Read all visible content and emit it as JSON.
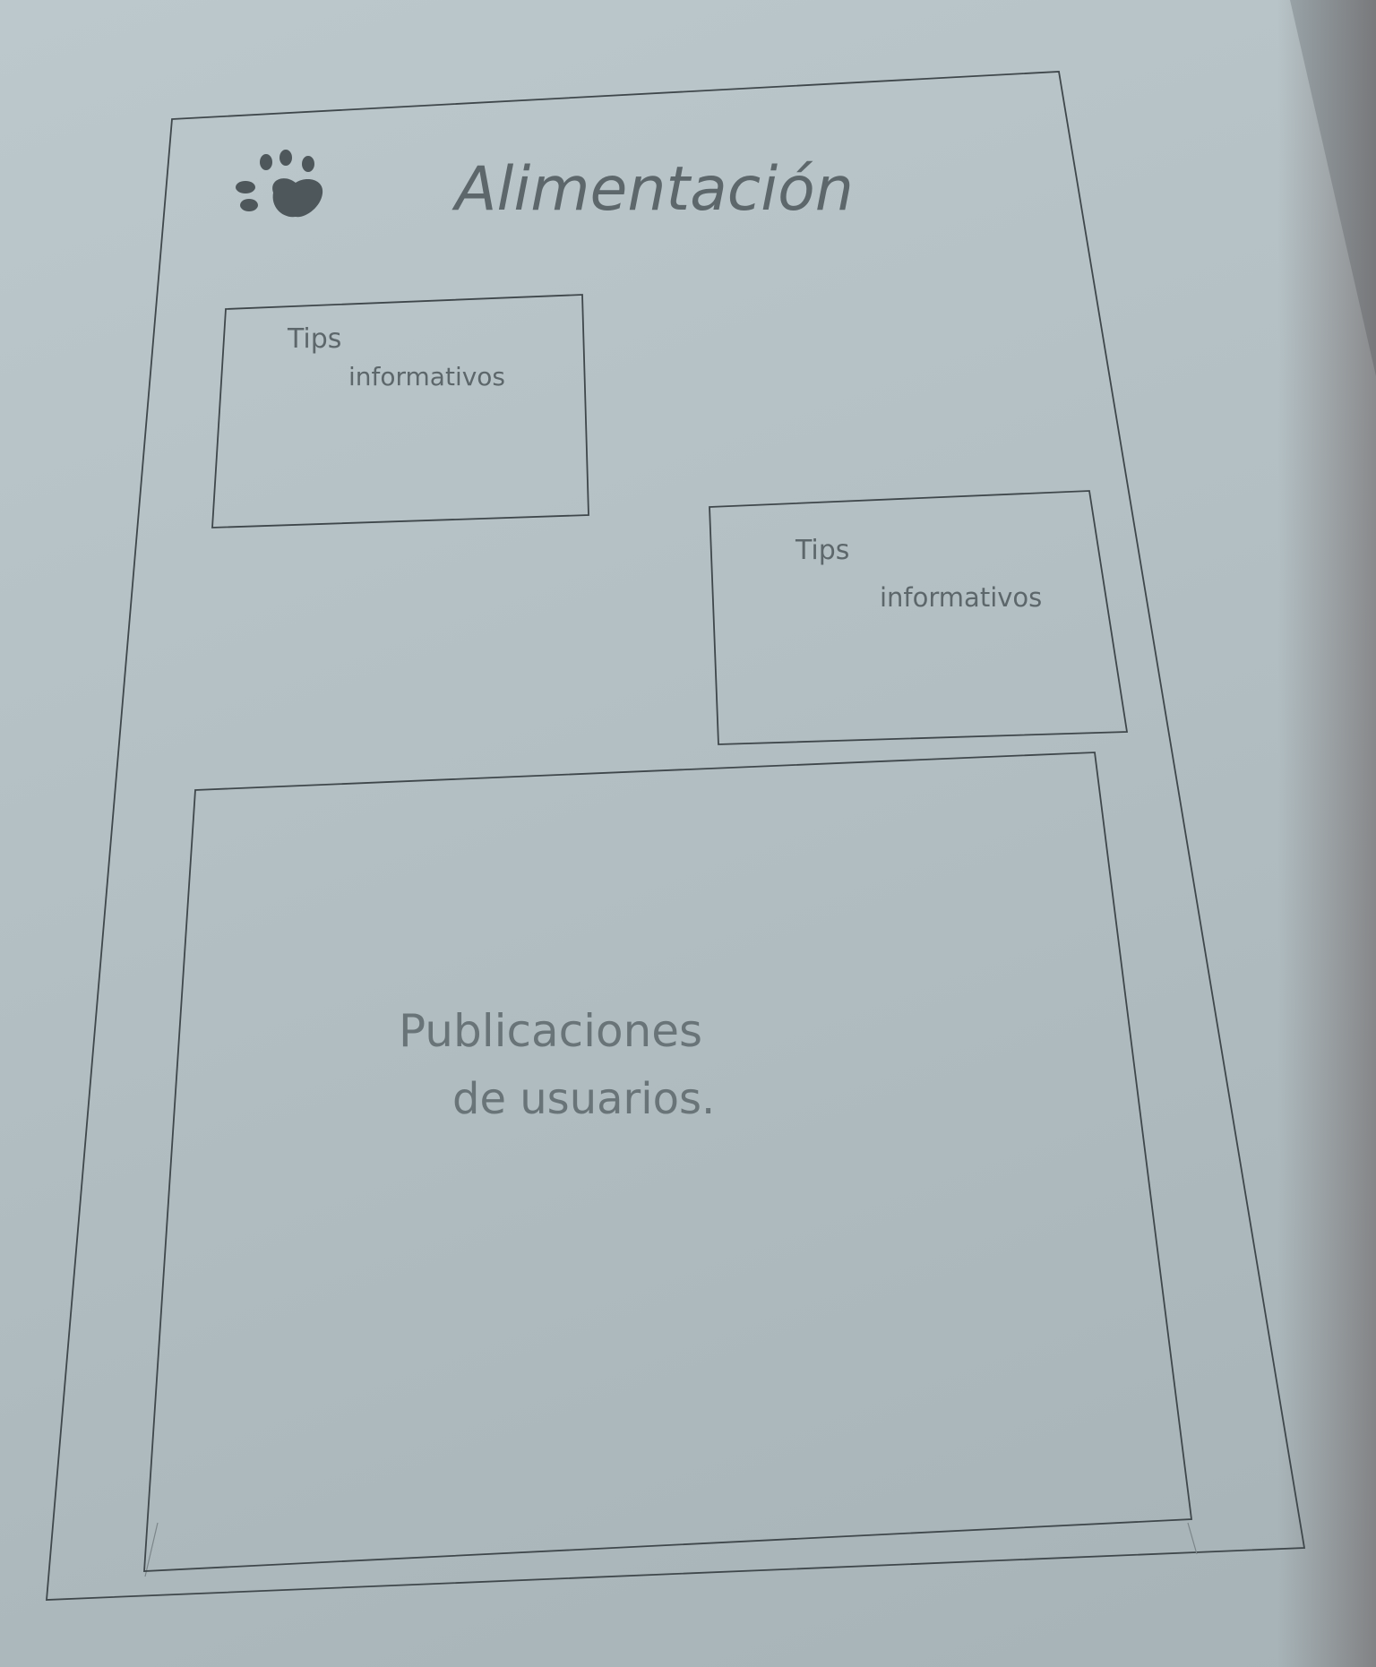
{
  "header": {
    "title": "Alimentación",
    "logo_icon": "paw-print-icon"
  },
  "tips": [
    {
      "line1": "Tips",
      "line2": "informativos"
    },
    {
      "line1": "Tips",
      "line2": "informativos"
    }
  ],
  "posts": {
    "line1": "Publicaciones",
    "line2": "de usuarios."
  }
}
